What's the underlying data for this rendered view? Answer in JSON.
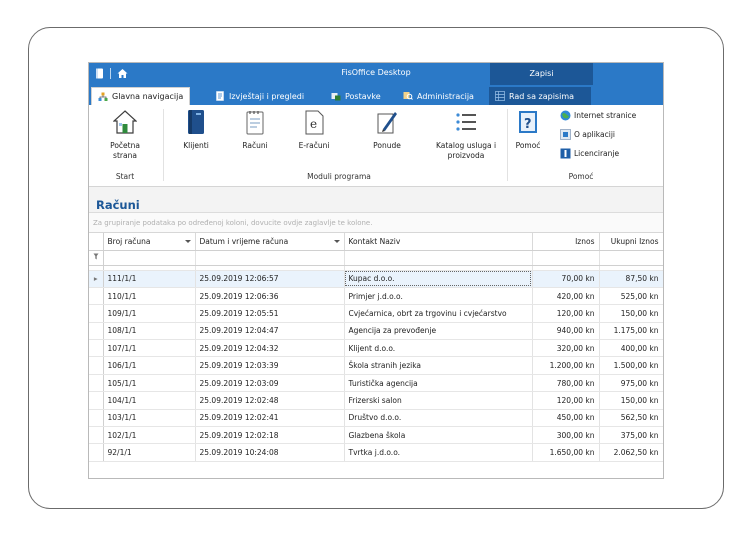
{
  "window": {
    "title": "FisOffice Desktop",
    "context_title": "Zapisi"
  },
  "tabs": [
    {
      "label": "Glavna navigacija"
    },
    {
      "label": "Izvještaji i pregledi"
    },
    {
      "label": "Postavke"
    },
    {
      "label": "Administracija"
    },
    {
      "label": "Rad sa zapisima"
    }
  ],
  "ribbon": {
    "start_group": {
      "label": "Start",
      "home": "Početna strana"
    },
    "modules_group": {
      "label": "Moduli programa",
      "clients": "Klijenti",
      "invoices": "Računi",
      "einvoices": "E-računi",
      "offers": "Ponude",
      "catalog": "Katalog usluga i proizvoda"
    },
    "help_group": {
      "label": "Pomoć",
      "help": "Pomoć",
      "internet": "Internet stranice",
      "about": "O aplikaciji",
      "licensing": "Licenciranje"
    }
  },
  "page": {
    "title": "Računi",
    "group_hint": "Za grupiranje podataka po određenoj koloni, dovucite ovdje zaglavlje te kolone."
  },
  "grid": {
    "columns": [
      "Broj računa",
      "Datum i vrijeme računa",
      "Kontakt Naziv",
      "Iznos",
      "Ukupni Iznos"
    ],
    "rows": [
      [
        "111/1/1",
        "25.09.2019 12:06:57",
        "Kupac d.o.o.",
        "70,00 kn",
        "87,50 kn"
      ],
      [
        "110/1/1",
        "25.09.2019 12:06:36",
        "Primjer j.d.o.o.",
        "420,00 kn",
        "525,00 kn"
      ],
      [
        "109/1/1",
        "25.09.2019 12:05:51",
        "Cvjećarnica, obrt za trgovinu i cvjećarstvo",
        "120,00 kn",
        "150,00 kn"
      ],
      [
        "108/1/1",
        "25.09.2019 12:04:47",
        "Agencija za prevođenje",
        "940,00 kn",
        "1.175,00 kn"
      ],
      [
        "107/1/1",
        "25.09.2019 12:04:32",
        "Klijent d.o.o.",
        "320,00 kn",
        "400,00 kn"
      ],
      [
        "106/1/1",
        "25.09.2019 12:03:39",
        "Škola stranih jezika",
        "1.200,00 kn",
        "1.500,00 kn"
      ],
      [
        "105/1/1",
        "25.09.2019 12:03:09",
        "Turistička agencija",
        "780,00 kn",
        "975,00 kn"
      ],
      [
        "104/1/1",
        "25.09.2019 12:02:48",
        "Frizerski salon",
        "120,00 kn",
        "150,00 kn"
      ],
      [
        "103/1/1",
        "25.09.2019 12:02:41",
        "Društvo d.o.o.",
        "450,00 kn",
        "562,50 kn"
      ],
      [
        "102/1/1",
        "25.09.2019 12:02:18",
        "Glazbena škola",
        "300,00 kn",
        "375,00 kn"
      ],
      [
        "92/1/1",
        "25.09.2019 10:24:08",
        "Tvrtka j.d.o.o.",
        "1.650,00 kn",
        "2.062,50 kn"
      ]
    ]
  },
  "colors": {
    "accent": "#2b79c7",
    "context": "#1c5797",
    "title": "#1c5797"
  }
}
